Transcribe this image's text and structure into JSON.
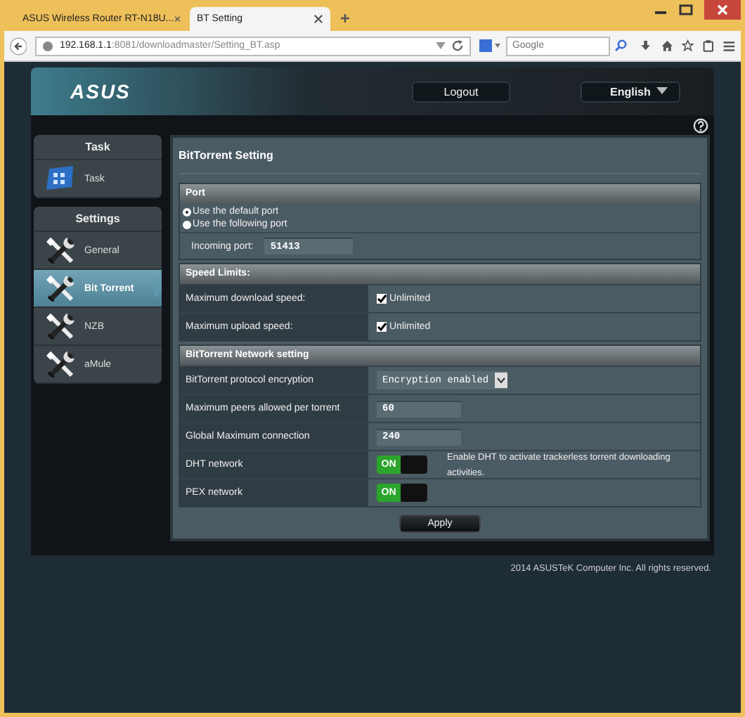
{
  "browser": {
    "tabs": [
      {
        "title": "ASUS Wireless Router RT-N18U...",
        "selected": false
      },
      {
        "title": "BT Setting",
        "selected": true
      }
    ],
    "new_tab": "+",
    "url": {
      "host": "192.168.1.1",
      "path": ":8081/downloadmaster/Setting_BT.asp"
    },
    "search": {
      "placeholder": "Google"
    }
  },
  "header": {
    "logo": "ASUS",
    "logout": "Logout",
    "language": "English"
  },
  "sidebar": [
    {
      "title": "Task",
      "items": [
        {
          "label": "Task",
          "kind": "task",
          "selected": false
        }
      ]
    },
    {
      "title": "Settings",
      "items": [
        {
          "label": "General",
          "kind": "tools",
          "selected": false
        },
        {
          "label": "Bit Torrent",
          "kind": "tools",
          "selected": true
        },
        {
          "label": "NZB",
          "kind": "tools",
          "selected": false
        },
        {
          "label": "aMule",
          "kind": "tools",
          "selected": false
        }
      ]
    }
  ],
  "page_title": "BitTorrent Setting",
  "port": {
    "title": "Port",
    "options": [
      {
        "label": "Use the default port",
        "selected": true
      },
      {
        "label": "Use the following port",
        "selected": false
      }
    ],
    "incoming_port": {
      "label": "Incoming port:",
      "value": "51413"
    }
  },
  "sections": [
    {
      "title": "Speed Limits:",
      "rows": [
        {
          "kind": "checkbox",
          "label": "Maximum download speed:",
          "text": "Unlimited",
          "checked": true
        },
        {
          "kind": "checkbox",
          "label": "Maximum upload speed:",
          "text": "Unlimited",
          "checked": true
        }
      ]
    },
    {
      "title": "BitTorrent Network setting",
      "rows": [
        {
          "kind": "select",
          "label": "BitTorrent protocol encryption",
          "value": "Encryption enabled"
        },
        {
          "kind": "input",
          "label": "Maximum peers allowed per torrent",
          "value": "60"
        },
        {
          "kind": "input",
          "label": "Global Maximum connection",
          "value": "240"
        },
        {
          "kind": "toggle",
          "label": "DHT network",
          "text": "ON",
          "on": true,
          "note": "Enable DHT to activate trackerless torrent downloading activities."
        },
        {
          "kind": "toggle",
          "label": "PEX network",
          "text": "ON",
          "on": true
        }
      ]
    }
  ],
  "apply": "Apply",
  "footer": "2014 ASUSTeK Computer Inc. All rights reserved."
}
